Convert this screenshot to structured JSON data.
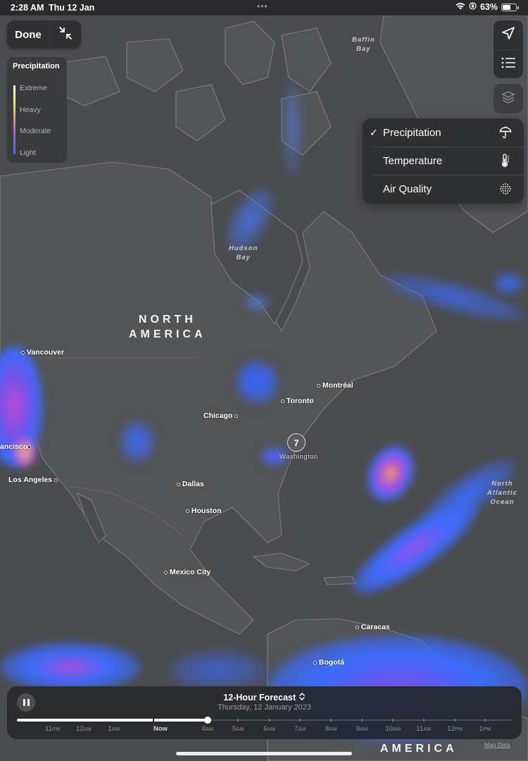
{
  "status_bar": {
    "time": "2:28 AM",
    "date": "Thu 12 Jan",
    "dots": "•••",
    "battery_percent": "63%",
    "battery_level": 0.63,
    "icons": [
      "wifi-icon",
      "orientation-lock-icon",
      "battery-icon"
    ]
  },
  "controls": {
    "done_label": "Done",
    "collapse_icon": "arrows-collapse-icon",
    "location_icon": "location-arrow-icon",
    "list_icon": "list-icon",
    "layers_icon": "layers-icon"
  },
  "legend": {
    "title": "Precipitation",
    "items": [
      "Extreme",
      "Heavy",
      "Moderate",
      "Light"
    ]
  },
  "layer_menu": {
    "items": [
      {
        "label": "Precipitation",
        "checked": true,
        "icon": "umbrella-icon"
      },
      {
        "label": "Temperature",
        "checked": false,
        "icon": "thermometer-icon"
      },
      {
        "label": "Air Quality",
        "checked": false,
        "icon": "air-quality-dots-icon"
      }
    ],
    "check_glyph": "✓"
  },
  "map": {
    "continents": {
      "north_america": "NORTH\nAMERICA",
      "south_america": "AMERICA"
    },
    "water": {
      "baffin": "Baffin\nBay",
      "hudson": "Hudson\nBay",
      "atlantic": "North\nAtlantic\nOcean"
    },
    "cities": {
      "vancouver": "Vancouver",
      "san_francisco": "ancisco",
      "los_angeles": "Los Angeles",
      "chicago": "Chicago",
      "toronto": "Toronto",
      "montreal": "Montréal",
      "washington": "Washington",
      "dallas": "Dallas",
      "houston": "Houston",
      "mexico_city": "Mexico City",
      "caracas": "Caracas",
      "bogota": "Bogotá"
    },
    "location_badge": "7"
  },
  "timeline": {
    "title": "12-Hour Forecast",
    "title_icon": "chevron-up-down-icon",
    "subtitle": "Thursday, 12 January 2023",
    "progress_fraction": 0.385,
    "now_fraction": 0.275,
    "labels": [
      {
        "num": "11",
        "suffix": "PM"
      },
      {
        "num": "12",
        "suffix": "AM"
      },
      {
        "num": "1",
        "suffix": "AM"
      },
      {
        "num": "Now",
        "suffix": ""
      },
      {
        "num": "4",
        "suffix": "AM"
      },
      {
        "num": "5",
        "suffix": "AM"
      },
      {
        "num": "6",
        "suffix": "AM"
      },
      {
        "num": "7",
        "suffix": "AM"
      },
      {
        "num": "8",
        "suffix": "AM"
      },
      {
        "num": "9",
        "suffix": "AM"
      },
      {
        "num": "10",
        "suffix": "AM"
      },
      {
        "num": "11",
        "suffix": "AM"
      },
      {
        "num": "12",
        "suffix": "PM"
      },
      {
        "num": "1",
        "suffix": "PM"
      }
    ]
  },
  "footer": {
    "map_data_link": "Map Data"
  }
}
